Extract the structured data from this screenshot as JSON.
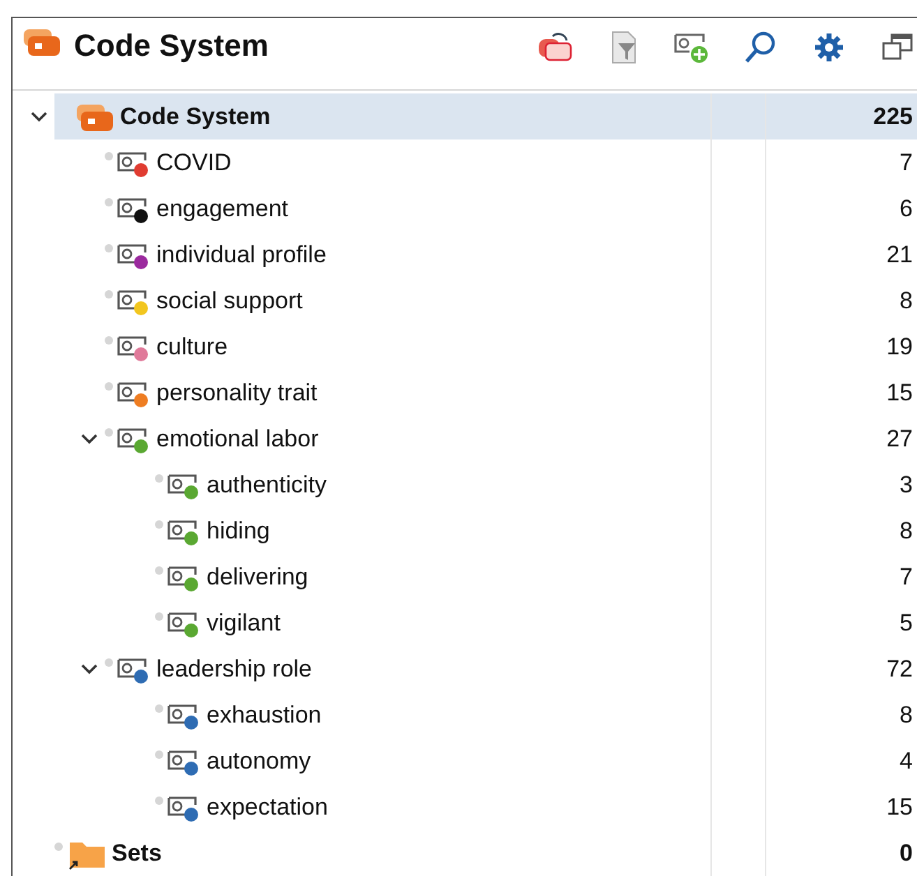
{
  "panel": {
    "title": "Code System"
  },
  "tree": [
    {
      "kind": "root",
      "label": "Code System",
      "count": "225",
      "selected": true,
      "expanded": true,
      "children": [
        {
          "kind": "code",
          "label": "COVID",
          "count": "7",
          "color": "#e03c31",
          "selected": false
        },
        {
          "kind": "code",
          "label": "engagement",
          "count": "6",
          "color": "#111111",
          "selected": false
        },
        {
          "kind": "code",
          "label": "individual profile",
          "count": "21",
          "color": "#9b2a9e",
          "selected": false
        },
        {
          "kind": "code",
          "label": "social support",
          "count": "8",
          "color": "#f2c61f",
          "selected": false
        },
        {
          "kind": "code",
          "label": "culture",
          "count": "19",
          "color": "#e07a9a",
          "selected": false
        },
        {
          "kind": "code",
          "label": "personality trait",
          "count": "15",
          "color": "#ee7d22",
          "selected": false
        },
        {
          "kind": "code",
          "label": "emotional labor",
          "count": "27",
          "color": "#5aa832",
          "selected": false,
          "expanded": true,
          "children": [
            {
              "kind": "code",
              "label": "authenticity",
              "count": "3",
              "color": "#5aa832",
              "selected": false
            },
            {
              "kind": "code",
              "label": "hiding",
              "count": "8",
              "color": "#5aa832",
              "selected": false
            },
            {
              "kind": "code",
              "label": "delivering",
              "count": "7",
              "color": "#5aa832",
              "selected": false
            },
            {
              "kind": "code",
              "label": "vigilant",
              "count": "5",
              "color": "#5aa832",
              "selected": false
            }
          ]
        },
        {
          "kind": "code",
          "label": "leadership role",
          "count": "72",
          "color": "#2e6cb3",
          "selected": false,
          "expanded": true,
          "children": [
            {
              "kind": "code",
              "label": "exhaustion",
              "count": "8",
              "color": "#2e6cb3",
              "selected": false
            },
            {
              "kind": "code",
              "label": "autonomy",
              "count": "4",
              "color": "#2e6cb3",
              "selected": false
            },
            {
              "kind": "code",
              "label": "expectation",
              "count": "15",
              "color": "#2e6cb3",
              "selected": false
            }
          ]
        }
      ]
    },
    {
      "kind": "set",
      "label": "Sets",
      "count": "0",
      "selected": false
    }
  ]
}
